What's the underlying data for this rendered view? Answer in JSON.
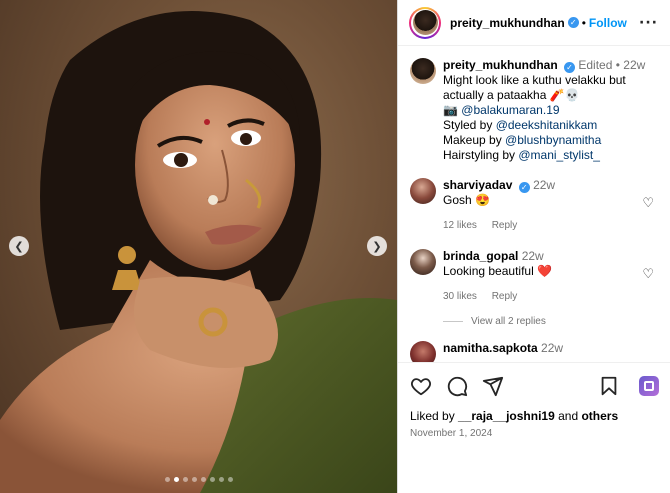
{
  "header": {
    "username": "preity_mukhundhan",
    "follow_label": "Follow",
    "sep": "•"
  },
  "caption": {
    "username": "preity_mukhundhan",
    "status": "Edited",
    "age": "22w",
    "line1": "Might look like a kuthu velakku but actually a pataakha 🧨💀",
    "mention_prefix": "📷",
    "mention": "@balakumaran.19",
    "styled_prefix": "Styled by ",
    "styled_by": "@deekshitanikkam",
    "makeup_prefix": "Makeup by ",
    "makeup_by": "@blushbynamitha",
    "hair_prefix": "Hairstyling by ",
    "hair_by": "@mani_stylist_"
  },
  "comments": [
    {
      "username": "sharviyadav",
      "age": "22w",
      "text": "Gosh 😍",
      "likes": "12 likes",
      "reply": "Reply"
    },
    {
      "username": "brinda_gopal",
      "age": "22w",
      "text": "Looking beautiful ❤️",
      "likes": "30 likes",
      "reply": "Reply"
    },
    {
      "username": "namitha.sapkota",
      "age": "22w"
    }
  ],
  "view_replies": "View all 2 replies",
  "footer": {
    "liked_prefix": "Liked by ",
    "liked_user": "__raja__joshni19",
    "liked_mid": " and ",
    "liked_others": "others",
    "date": "November 1, 2024"
  },
  "carousel": {
    "slides": 8,
    "active_index": 1
  },
  "colors": {
    "accent": "#0095f6",
    "verified": "#3897f0",
    "muted": "#737373"
  },
  "icons": [
    "heart-icon",
    "comment-icon",
    "share-icon",
    "bookmark-icon",
    "more-icon",
    "chevron-left-icon",
    "chevron-right-icon",
    "verified-icon"
  ]
}
